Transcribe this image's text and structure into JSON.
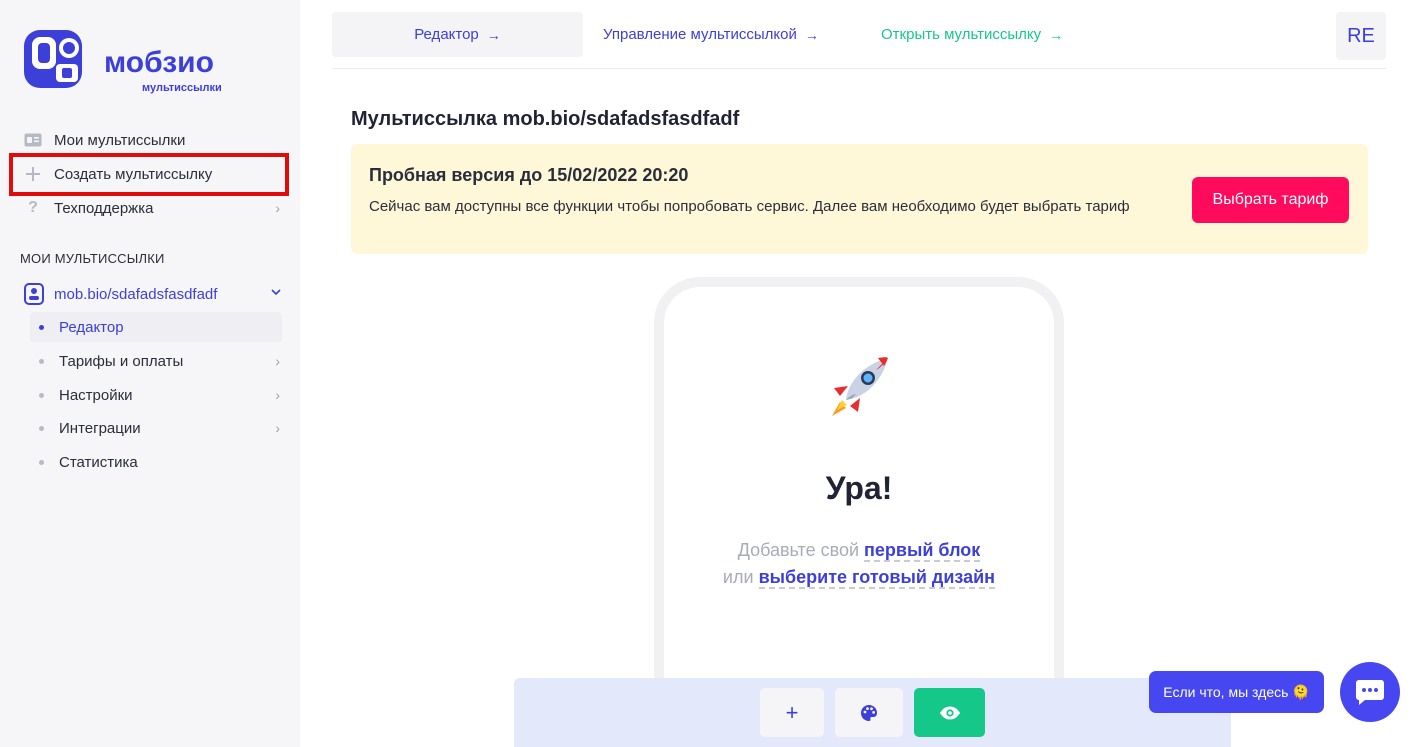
{
  "brand": {
    "name": "мобзио",
    "tagline": "мультиссылки",
    "colors": {
      "primary": "#3d3fd9",
      "accent_green": "#16c78a",
      "accent_pink": "#ff0a5c",
      "chat": "#4747f1",
      "highlight": "#e00b0b"
    }
  },
  "sidebar": {
    "items": [
      {
        "label": "Мои мультиссылки",
        "icon": "id-card-icon"
      },
      {
        "label": "Создать мультиссылку",
        "icon": "plus-icon"
      },
      {
        "label": "Техподдержка",
        "icon": "question-icon"
      }
    ],
    "section_title": "МОИ МУЛЬТИССЫЛКИ",
    "project": {
      "label": "mob.bio/sdafadsfasdfadf",
      "icon": "phone-profile-icon",
      "sub_items": [
        {
          "label": "Редактор",
          "active": true
        },
        {
          "label": "Тарифы и оплаты"
        },
        {
          "label": "Настройки"
        },
        {
          "label": "Интеграции"
        },
        {
          "label": "Статистика"
        }
      ]
    }
  },
  "topbar": {
    "tabs": [
      {
        "label": "Редактор"
      },
      {
        "label": "Управление мультиссылкой"
      },
      {
        "label": "Открыть мультиссылку"
      }
    ],
    "avatar": "RE"
  },
  "main": {
    "title": "Мультиссылка mob.bio/sdafadsfasdfadf",
    "trial": {
      "title": "Пробная версия до 15/02/2022 20:20",
      "text": "Сейчас вам доступны все функции чтобы попробовать сервис. Далее вам необходимо будет выбрать тариф",
      "button": "Выбрать тариф"
    },
    "preview": {
      "heading": "Ура!",
      "line1_prefix": "Добавьте свой",
      "line1_link": "первый блок",
      "line2_prefix": "или",
      "line2_link": "выберите готовый дизайн"
    }
  },
  "toolbar": {
    "add": "+",
    "palette_icon": "palette-icon",
    "eye_icon": "eye-icon"
  },
  "chat": {
    "bubble": "Если что, мы здесь 🫠"
  }
}
